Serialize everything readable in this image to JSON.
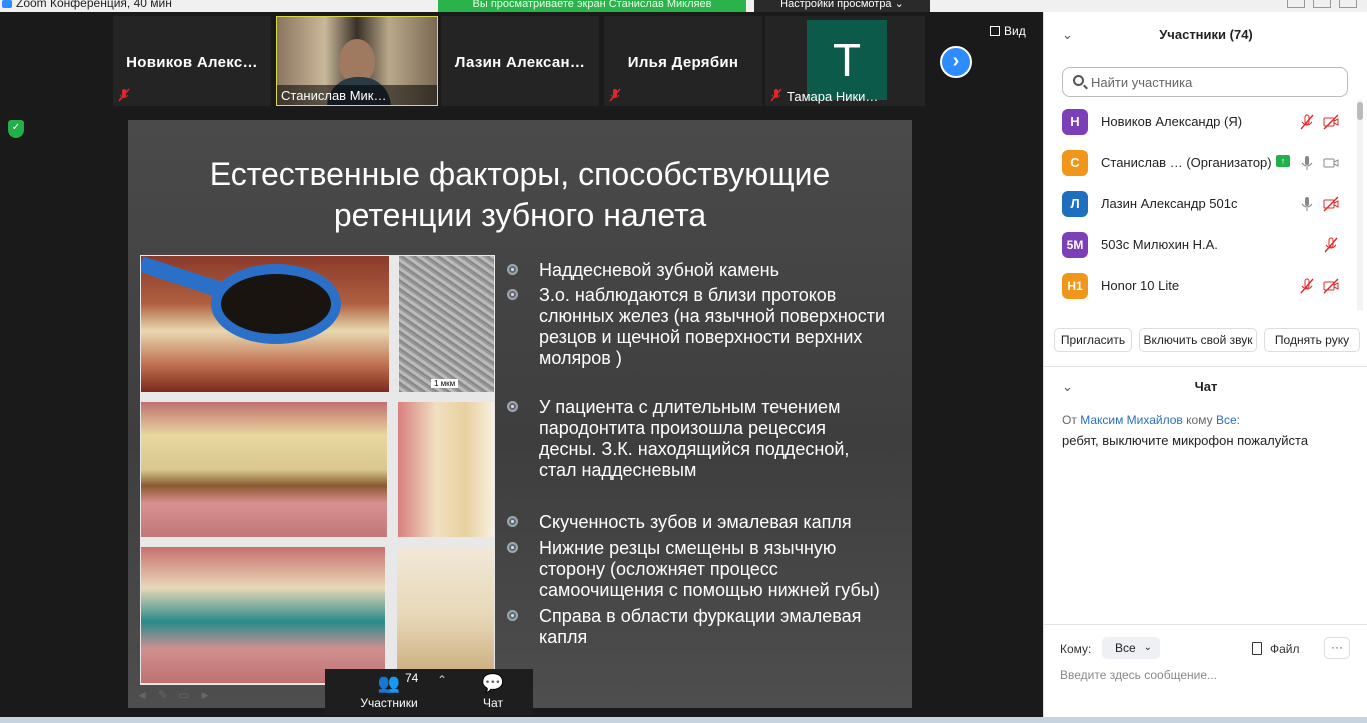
{
  "window": {
    "title": "Zoom Конференция, 40 мин"
  },
  "banner": {
    "text": "Вы просматриваете экран Станислав Микляев",
    "view_settings": "Настройки просмотра",
    "view_settings_chevron": "chevron-down-icon"
  },
  "strip": {
    "tiles": [
      {
        "name": "Новиков  Алекс…",
        "mic": "muted"
      },
      {
        "name": "Станислав Мик…",
        "video": true
      },
      {
        "name": "Лазин  Алексан…"
      },
      {
        "name": "Илья Дерябин",
        "mic": "muted"
      },
      {
        "avatar_letter": "T",
        "name": "Тамара Ники…",
        "mic": "muted",
        "avatar_color": "#0c5a4a"
      }
    ],
    "next_icon": "chevron-right-icon",
    "view_label": "Вид"
  },
  "slide": {
    "title_line1": "Естественные факторы, способствующие",
    "title_line2": "ретенции зубного налета",
    "scale_label": "1 мкм",
    "bullets": [
      "Наддесневой зубной камень",
      "З.о. наблюдаются в близи протоков слюнных желез (на язычной поверхности резцов и щечной поверхности верхних моляров )",
      "У пациента с длительным течением пародонтита произошла рецессия десны. З.К. находящийся поддесной, стал наддесневым",
      "Скученность зубов и эмалевая капля",
      "Нижние резцы смещены в язычную сторону (осложняет процесс самоочищения с помощью нижней губы)",
      "Справа в области фуркации эмалевая капля"
    ]
  },
  "toolbar": {
    "participants_label": "Участники",
    "participants_count": "74",
    "chat_label": "Чат"
  },
  "panel": {
    "title": "Участники (74)",
    "search_placeholder": "Найти участника",
    "participants": [
      {
        "initials": "Н",
        "color": "#7d3fb8",
        "name": "Новиков Александр (Я)",
        "mic": "muted",
        "cam": "off"
      },
      {
        "initials": "С",
        "color": "#f0961b",
        "name": "Станислав …  (Организатор)",
        "mic": "on",
        "cam": "on",
        "sharing": true
      },
      {
        "initials": "Л",
        "color": "#1f6fbf",
        "name": "Лазин Александр 501с",
        "mic": "on",
        "cam": "off"
      },
      {
        "initials": "5М",
        "color": "#7d3fb8",
        "name": "503с Милюхин Н.А.",
        "mic": "muted"
      },
      {
        "initials": "H1",
        "color": "#f0961b",
        "name": "Honor 10 Lite",
        "mic": "muted",
        "cam": "off"
      }
    ],
    "buttons": {
      "invite": "Пригласить",
      "unmute": "Включить свой звук",
      "raise_hand": "Поднять руку"
    },
    "chat": {
      "title": "Чат",
      "from_prefix": "От",
      "from": "Максим Михайлов",
      "to_word": "кому",
      "to": "Все:",
      "message": "ребят, выключите микрофон пожалуйста",
      "to_label": "Кому:",
      "to_value": "Все",
      "file_label": "Файл",
      "more_label": "···",
      "input_placeholder": "Введите здесь сообщение..."
    }
  }
}
